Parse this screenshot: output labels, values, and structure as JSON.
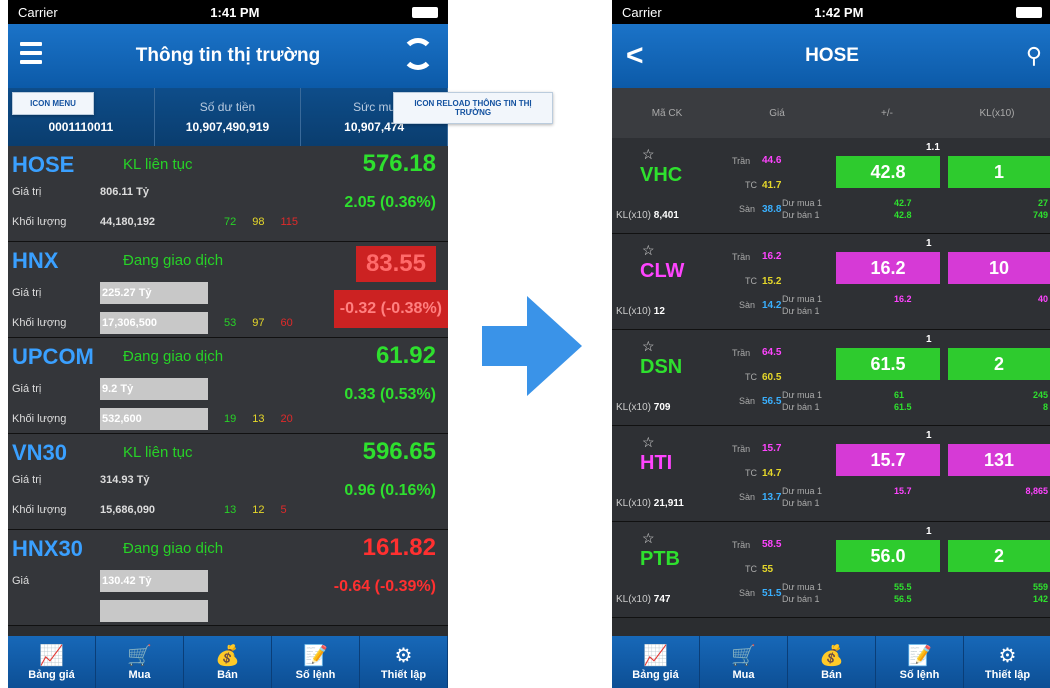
{
  "phone1": {
    "carrier": "Carrier",
    "time": "1:41 PM",
    "title": "Thông tin thị trường",
    "menu_tip": "ICON MENU",
    "reload_tip": "ICON RELOAD THÔNG TIN THỊ TRƯỜNG",
    "account": [
      {
        "label": "bản",
        "value": "0001110011"
      },
      {
        "label": "Số dư tiền",
        "value": "10,907,490,919"
      },
      {
        "label": "Sức mu",
        "value": "10,907,474"
      }
    ],
    "markets": [
      {
        "name": "HOSE",
        "status": "KL liên tục",
        "gt_label": "Giá trị",
        "gt": "806.11 Tỷ",
        "kl_label": "Khối lượng",
        "kl": "44,180,192",
        "up": "72",
        "ref": "98",
        "down": "115",
        "index": "576.18",
        "change": "2.05 (0.36%)",
        "color": "#2ee02e",
        "gray": false
      },
      {
        "name": "HNX",
        "status": "Đang giao dịch",
        "gt_label": "Giá trị",
        "gt": "225.27 Tỷ",
        "kl_label": "Khối lượng",
        "kl": "17,306,500",
        "up": "53",
        "ref": "97",
        "down": "60",
        "index": "83.55",
        "change": "-0.32 (-0.38%)",
        "color": "#ff3030",
        "gray": true
      },
      {
        "name": "UPCOM",
        "status": "Đang giao dịch",
        "gt_label": "Giá trị",
        "gt": "9.2 Tỷ",
        "kl_label": "Khối lượng",
        "kl": "532,600",
        "up": "19",
        "ref": "13",
        "down": "20",
        "index": "61.92",
        "change": "0.33 (0.53%)",
        "color": "#2ee02e",
        "gray": true
      },
      {
        "name": "VN30",
        "status": "KL liên tục",
        "gt_label": "Giá trị",
        "gt": "314.93 Tỷ",
        "kl_label": "Khối lượng",
        "kl": "15,686,090",
        "up": "13",
        "ref": "12",
        "down": "5",
        "index": "596.65",
        "change": "0.96 (0.16%)",
        "color": "#2ee02e",
        "gray": false
      },
      {
        "name": "HNX30",
        "status": "Đang giao dịch",
        "gt_label": "Giá",
        "gt": "130.42 Tỷ",
        "kl_label": "",
        "kl": "",
        "up": "",
        "ref": "",
        "down": "",
        "index": "161.82",
        "change": "-0.64 (-0.39%)",
        "color": "#ff3030",
        "gray": true
      }
    ]
  },
  "phone2": {
    "carrier": "Carrier",
    "time": "1:42 PM",
    "title": "HOSE",
    "headers": [
      "Mã CK",
      "Giá",
      "+/-",
      "KL(x10)"
    ],
    "labels": {
      "tran": "Trần",
      "tc": "TC",
      "san": "Sàn",
      "dumua": "Dư mua 1",
      "duban": "Dư bán 1",
      "kl": "KL(x10)"
    },
    "stocks": [
      {
        "sym": "VHC",
        "color": "#2ee02e",
        "tran": "44.6",
        "tc": "41.7",
        "san": "38.8",
        "kl": "8,401",
        "price": "42.8",
        "chg": "1.1",
        "vol": "1",
        "box": "#2ecb2e",
        "dm": "42.7",
        "db": "42.8",
        "dmv": "27",
        "dbv": "749"
      },
      {
        "sym": "CLW",
        "color": "#ff44ff",
        "tran": "16.2",
        "tc": "15.2",
        "san": "14.2",
        "kl": "12",
        "price": "16.2",
        "chg": "1",
        "vol": "10",
        "box": "#d63ad6",
        "dm": "16.2",
        "db": "",
        "dmv": "40",
        "dbv": ""
      },
      {
        "sym": "DSN",
        "color": "#2ee02e",
        "tran": "64.5",
        "tc": "60.5",
        "san": "56.5",
        "kl": "709",
        "price": "61.5",
        "chg": "1",
        "vol": "2",
        "box": "#2ecb2e",
        "dm": "61",
        "db": "61.5",
        "dmv": "245",
        "dbv": "8"
      },
      {
        "sym": "HTI",
        "color": "#ff44ff",
        "tran": "15.7",
        "tc": "14.7",
        "san": "13.7",
        "kl": "21,911",
        "price": "15.7",
        "chg": "1",
        "vol": "131",
        "box": "#d63ad6",
        "dm": "15.7",
        "db": "",
        "dmv": "8,865",
        "dbv": ""
      },
      {
        "sym": "PTB",
        "color": "#2ee02e",
        "tran": "58.5",
        "tc": "55",
        "san": "51.5",
        "kl": "747",
        "price": "56.0",
        "chg": "1",
        "vol": "2",
        "box": "#2ecb2e",
        "dm": "55.5",
        "db": "56.5",
        "dmv": "559",
        "dbv": "142"
      }
    ]
  },
  "tabs": [
    {
      "label": "Bảng giá",
      "icon": "chart-icon"
    },
    {
      "label": "Mua",
      "icon": "buy-icon"
    },
    {
      "label": "Bán",
      "icon": "sell-icon"
    },
    {
      "label": "Số lệnh",
      "icon": "orders-icon"
    },
    {
      "label": "Thiết lập",
      "icon": "settings-icon"
    }
  ]
}
